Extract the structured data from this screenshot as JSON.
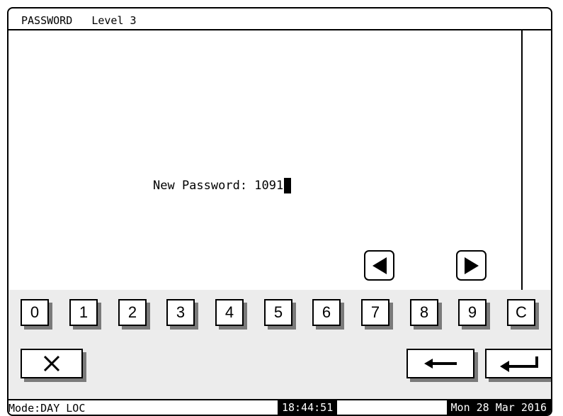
{
  "header": {
    "title": "PASSWORD   Level 3"
  },
  "main": {
    "prompt_label": "New Password: ",
    "password_value": "1091"
  },
  "nav": {
    "left_icon": "triangle-left-icon",
    "right_icon": "triangle-right-icon"
  },
  "keypad": {
    "keys": [
      "0",
      "1",
      "2",
      "3",
      "4",
      "5",
      "6",
      "7",
      "8",
      "9",
      "C"
    ],
    "cancel_icon": "x-icon",
    "backspace_icon": "left-arrow-icon",
    "enter_icon": "enter-arrow-icon"
  },
  "status": {
    "mode": "Mode:DAY LOC",
    "time": "18:44:51",
    "date": "Mon 28 Mar 2016"
  }
}
